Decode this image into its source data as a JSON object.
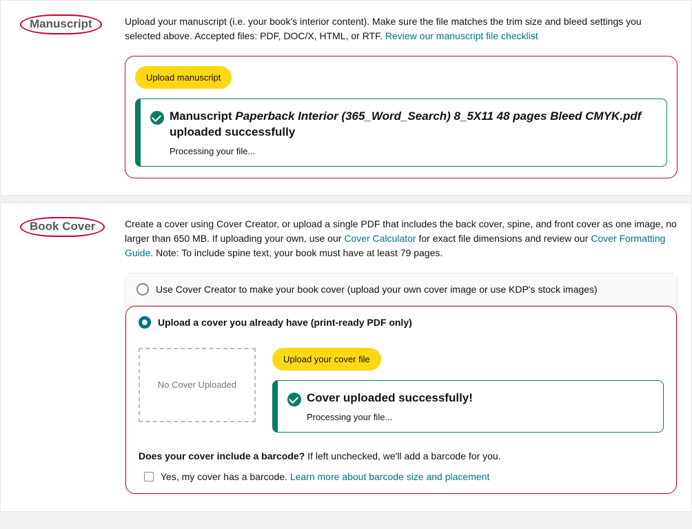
{
  "manuscript": {
    "heading": "Manuscript",
    "desc_pre": "Upload your manuscript (i.e. your book's interior content). Make sure the file matches the trim size and bleed settings you selected above. Accepted files: PDF, DOC/X, HTML, or RTF. ",
    "desc_link": "Review our manuscript file checklist",
    "upload_btn": "Upload manuscript",
    "success_pre": "Manuscript ",
    "success_file": "Paperback Interior (365_Word_Search) 8_5X11 48 pages Bleed CMYK.pdf",
    "success_post": " uploaded successfully",
    "processing": "Processing your file..."
  },
  "cover": {
    "heading": "Book Cover",
    "desc1": "Create a cover using Cover Creator, or upload a single PDF that includes the back cover, spine, and front cover as one image, no larger than 650 MB. If uploading your own, use our ",
    "link1": "Cover Calculator",
    "desc2": " for exact file dimensions and review our ",
    "link2": "Cover Formatting Guide",
    "desc3": ". Note: To include spine text, your book must have at least 79 pages.",
    "option1": "Use Cover Creator to make your book cover (upload your own cover image or use KDP's stock images)",
    "option2": "Upload a cover you already have (print-ready PDF only)",
    "placeholder": "No Cover Uploaded",
    "upload_btn": "Upload your cover file",
    "success_title": "Cover uploaded successfully!",
    "processing": "Processing your file...",
    "barcode_q_bold": "Does your cover include a barcode?",
    "barcode_q_rest": " If left unchecked, we'll add a barcode for you.",
    "barcode_check_label": "Yes, my cover has a barcode. ",
    "barcode_link": "Learn more about barcode size and placement"
  }
}
